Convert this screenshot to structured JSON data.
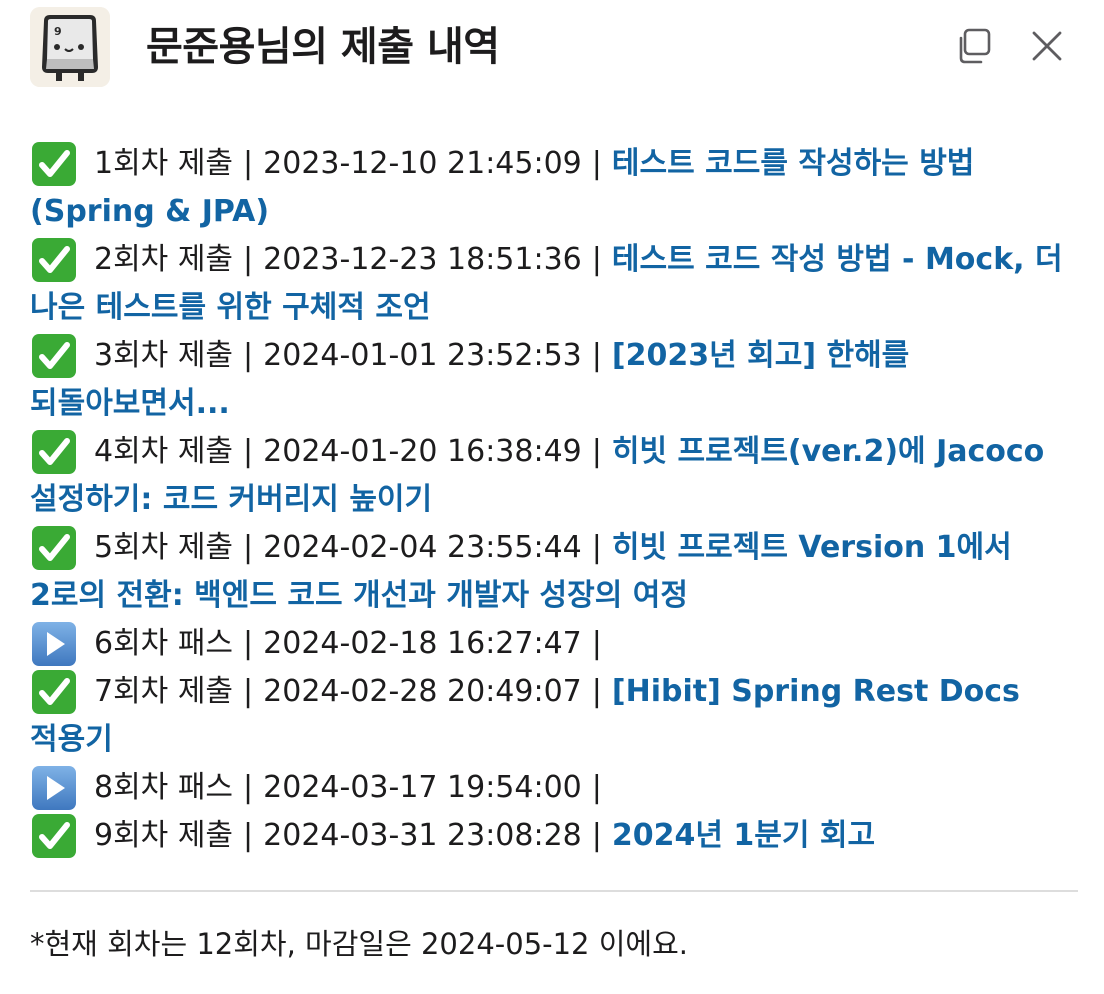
{
  "header": {
    "title": "문준용님의 제출 내역",
    "avatar_icon": "keyboard-key-9-mascot",
    "copy_icon": "copy-icon",
    "close_icon": "close-icon"
  },
  "colors": {
    "link": "#1264a3",
    "check": "#3aaa35",
    "pass": "#4a8ad0"
  },
  "entries": [
    {
      "status_icon": "check-mark-button",
      "round": "1회차 제출",
      "datetime": "2023-12-10 21:45:09",
      "separator": "|",
      "title": "테스트 코드를 작성하는 방법 (Spring & JPA)"
    },
    {
      "status_icon": "check-mark-button",
      "round": "2회차 제출",
      "datetime": "2023-12-23 18:51:36",
      "separator": "|",
      "title": "테스트 코드 작성 방법 - Mock, 더 나은 테스트를 위한 구체적 조언"
    },
    {
      "status_icon": "check-mark-button",
      "round": "3회차 제출",
      "datetime": "2024-01-01 23:52:53",
      "separator": "|",
      "title": "[2023년 회고] 한해를 되돌아보면서..."
    },
    {
      "status_icon": "check-mark-button",
      "round": "4회차 제출",
      "datetime": "2024-01-20 16:38:49",
      "separator": "|",
      "title": "히빗 프로젝트(ver.2)에 Jacoco 설정하기: 코드 커버리지 높이기"
    },
    {
      "status_icon": "check-mark-button",
      "round": "5회차 제출",
      "datetime": "2024-02-04 23:55:44",
      "separator": "|",
      "title": "히빗 프로젝트 Version 1에서 2로의 전환: 백엔드 코드 개선과 개발자 성장의 여정"
    },
    {
      "status_icon": "play-button",
      "round": "6회차 패스",
      "datetime": "2024-02-18 16:27:47",
      "separator": "|",
      "title": ""
    },
    {
      "status_icon": "check-mark-button",
      "round": "7회차 제출",
      "datetime": "2024-02-28 20:49:07",
      "separator": "|",
      "title": "[Hibit] Spring Rest Docs 적용기"
    },
    {
      "status_icon": "play-button",
      "round": "8회차 패스",
      "datetime": "2024-03-17 19:54:00",
      "separator": "|",
      "title": ""
    },
    {
      "status_icon": "check-mark-button",
      "round": "9회차 제출",
      "datetime": "2024-03-31 23:08:28",
      "separator": "|",
      "title": "2024년 1분기 회고"
    }
  ],
  "footer": {
    "note": "*현재 회차는 12회차, 마감일은 2024-05-12 이에요."
  }
}
